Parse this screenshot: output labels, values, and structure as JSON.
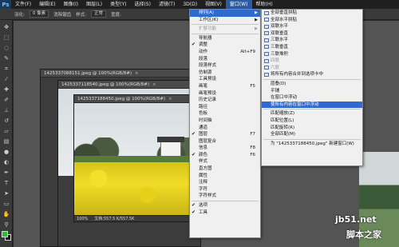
{
  "menubar": {
    "logo": "Ps",
    "items": [
      {
        "label": "文件(F)"
      },
      {
        "label": "编辑(E)"
      },
      {
        "label": "图像(I)"
      },
      {
        "label": "图层(L)"
      },
      {
        "label": "类型(Y)"
      },
      {
        "label": "选择(S)"
      },
      {
        "label": "滤镜(T)"
      },
      {
        "label": "3D(D)"
      },
      {
        "label": "视图(V)"
      },
      {
        "label": "窗口(W)"
      },
      {
        "label": "帮助(H)"
      }
    ],
    "active_index": 9
  },
  "options": {
    "feather_label": "羽化:",
    "feather_value": "0 像素",
    "antialias_label": "消除锯齿",
    "style_label": "样式:",
    "style_value": "正常",
    "width_label": "宽度:"
  },
  "documents": [
    {
      "title": "1425337088151.jpeg @ 100%(RGB/8#)"
    },
    {
      "title": "1425337118540.jpeg @ 100%(RGB/8#)"
    },
    {
      "title": "1425337188450.jpeg @ 100%(RGB/8#)",
      "zoom": "100%",
      "doc_info": "文档:557.5 K/557.5K"
    }
  ],
  "window_menu": [
    {
      "label": "排列(A)",
      "submenu": true,
      "highlight": true
    },
    {
      "label": "工作区(K)",
      "submenu": true
    },
    {
      "sep": true
    },
    {
      "label": "扩展功能",
      "submenu": true,
      "disabled": true
    },
    {
      "sep": true
    },
    {
      "label": "导航器"
    },
    {
      "label": "调整",
      "check": true
    },
    {
      "label": "动作",
      "shortcut": "Alt+F9"
    },
    {
      "label": "段落"
    },
    {
      "label": "段落样式"
    },
    {
      "label": "仿制源"
    },
    {
      "label": "工具预设"
    },
    {
      "label": "画笔",
      "shortcut": "F5"
    },
    {
      "label": "画笔预设"
    },
    {
      "label": "历史记录"
    },
    {
      "label": "路径"
    },
    {
      "label": "色板"
    },
    {
      "label": "时间轴"
    },
    {
      "label": "通道"
    },
    {
      "label": "图层",
      "shortcut": "F7",
      "check": true
    },
    {
      "label": "图层复合"
    },
    {
      "label": "信息",
      "shortcut": "F8"
    },
    {
      "label": "颜色",
      "shortcut": "F6",
      "check": true
    },
    {
      "label": "样式"
    },
    {
      "label": "直方图"
    },
    {
      "label": "属性"
    },
    {
      "label": "注释"
    },
    {
      "label": "字符"
    },
    {
      "label": "字符样式"
    },
    {
      "sep": true
    },
    {
      "label": "选项",
      "check": true
    },
    {
      "label": "工具",
      "check": true
    }
  ],
  "arrange_submenu": [
    {
      "label": "全部垂直拼贴",
      "icon": true
    },
    {
      "label": "全部水平拼贴",
      "icon": true
    },
    {
      "label": "双联水平",
      "icon": true
    },
    {
      "label": "双联垂直",
      "icon": true
    },
    {
      "label": "三联水平",
      "icon": true
    },
    {
      "label": "三联垂直",
      "icon": true
    },
    {
      "label": "三联堆积",
      "icon": true
    },
    {
      "label": "四联",
      "icon": true,
      "disabled": true
    },
    {
      "label": "六联",
      "icon": true,
      "disabled": true
    },
    {
      "label": "将所有内容合并到选项卡中",
      "icon": true
    },
    {
      "sep": true
    },
    {
      "label": "层叠(D)"
    },
    {
      "label": "平铺"
    },
    {
      "label": "在窗口中浮动"
    },
    {
      "label": "使所有内容在窗口中浮动",
      "highlight": true
    },
    {
      "sep": true
    },
    {
      "label": "匹配缩放(Z)"
    },
    {
      "label": "匹配位置(L)"
    },
    {
      "label": "匹配旋转(R)"
    },
    {
      "label": "全部匹配(M)"
    },
    {
      "sep": true
    },
    {
      "label": "为 \"1425337188450.jpeg\" 新建窗口(W)"
    }
  ],
  "watermark": {
    "line1": "jb51.net",
    "line2": "脚本之家"
  },
  "colors": {
    "highlight": "#2f6ad0",
    "menu_bg": "#f0f0f0",
    "fg_swatch": "#22c522"
  }
}
